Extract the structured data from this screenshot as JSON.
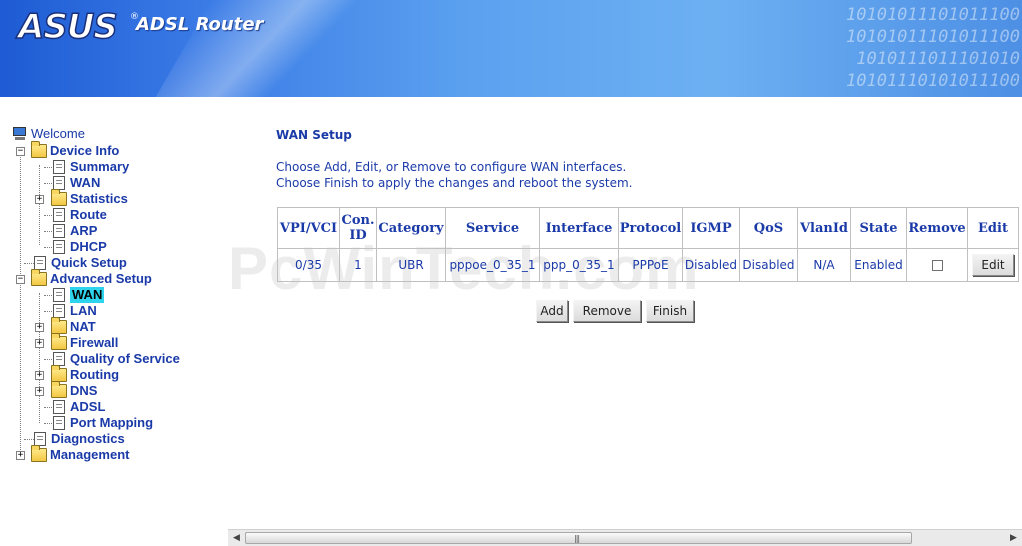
{
  "banner": {
    "logo": "ASUS",
    "product": "ADSL Router",
    "binary_lines": [
      "10101011101011100",
      "10101011101011100",
      "1010111011101010",
      "10101110101011100"
    ]
  },
  "nav": {
    "welcome": "Welcome",
    "device_info": "Device Info",
    "summary": "Summary",
    "wan": "WAN",
    "statistics": "Statistics",
    "route": "Route",
    "arp": "ARP",
    "dhcp": "DHCP",
    "quick_setup": "Quick Setup",
    "advanced_setup": "Advanced Setup",
    "adv_wan": "WAN",
    "lan": "LAN",
    "nat": "NAT",
    "firewall": "Firewall",
    "qos": "Quality of Service",
    "routing": "Routing",
    "dns": "DNS",
    "adsl": "ADSL",
    "port_mapping": "Port Mapping",
    "diagnostics": "Diagnostics",
    "management": "Management"
  },
  "page": {
    "title": "WAN Setup",
    "line1": "Choose Add, Edit, or Remove to configure WAN interfaces.",
    "line2": "Choose Finish to apply the changes and reboot the system."
  },
  "table": {
    "headers": {
      "vpi_vci": "VPI/VCI",
      "con_id_1": "Con.",
      "con_id_2": "ID",
      "category": "Category",
      "service": "Service",
      "interface": "Interface",
      "protocol": "Protocol",
      "igmp": "IGMP",
      "qos": "QoS",
      "vlanid": "VlanId",
      "state": "State",
      "remove": "Remove",
      "edit": "Edit"
    },
    "row": {
      "vpi_vci": "0/35",
      "con_id": "1",
      "category": "UBR",
      "service": "pppoe_0_35_1",
      "interface": "ppp_0_35_1",
      "protocol": "PPPoE",
      "igmp": "Disabled",
      "qos": "Disabled",
      "vlanid": "N/A",
      "state": "Enabled",
      "edit_label": "Edit"
    }
  },
  "buttons": {
    "add": "Add",
    "remove": "Remove",
    "finish": "Finish"
  },
  "watermark": "PcWinTech.com",
  "colors": {
    "link_blue": "#1a3aa8",
    "selected_bg": "#2ed4ee"
  }
}
